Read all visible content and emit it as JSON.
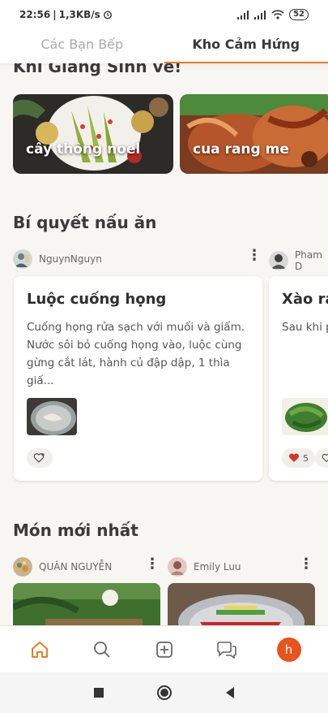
{
  "status_bar": {
    "time": "22:56",
    "network_speed": "1,3KB/s",
    "battery": "52"
  },
  "tabs": [
    {
      "label": "Các Bạn Bếp",
      "active": false
    },
    {
      "label": "Kho Cảm Hứng",
      "active": true
    }
  ],
  "inspiration": {
    "title": "Khi Giáng Sinh về!",
    "cards": [
      {
        "label": "cây thông noel"
      },
      {
        "label": "cua rang me"
      }
    ]
  },
  "tips": {
    "title": "Bí quyết nấu ăn",
    "cards": [
      {
        "author": "NguynNguyn",
        "title": "Luộc cuống họng",
        "description": "Cuống họng rửa sạch với muối và giấm. Nước sôi bỏ cuống họng vào, luộc cùng gừng cắt lát, hành củ đập dập, 1 thìa giấ...",
        "reactions": ""
      },
      {
        "author": "Pham D",
        "title": "Xào ra",
        "description": "Sau khi p Nhưng c rau vào c",
        "reactions": "5"
      }
    ]
  },
  "latest": {
    "title": "Món mới nhất",
    "authors": [
      "QUÂN NGUYỄN",
      "Emily Luu"
    ]
  },
  "bottom_nav": {
    "items": [
      "home-icon",
      "search-icon",
      "add-icon",
      "chat-icon"
    ],
    "user_initial": "h"
  },
  "colors": {
    "accent": "#f07c24",
    "avatar": "#e8541e"
  }
}
